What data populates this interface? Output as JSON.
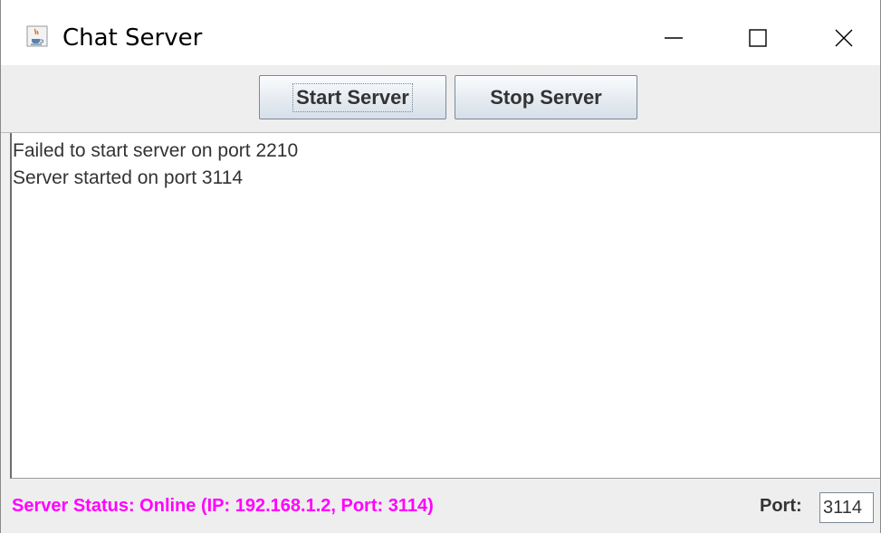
{
  "window": {
    "title": "Chat Server",
    "icon": "java-cup-icon"
  },
  "titlebar_controls": {
    "minimize_icon": "minimize-icon",
    "maximize_icon": "maximize-icon",
    "close_icon": "close-icon"
  },
  "toolbar": {
    "start_label": "Start Server",
    "stop_label": "Stop Server"
  },
  "log": {
    "lines": [
      "Failed to start server on port 2210",
      "Server started on port 3114"
    ]
  },
  "status": {
    "text": "Server Status: Online (IP: 192.168.1.2, Port: 3114)",
    "color": "#ff00ff",
    "port_label": "Port:",
    "port_value": "3114"
  }
}
